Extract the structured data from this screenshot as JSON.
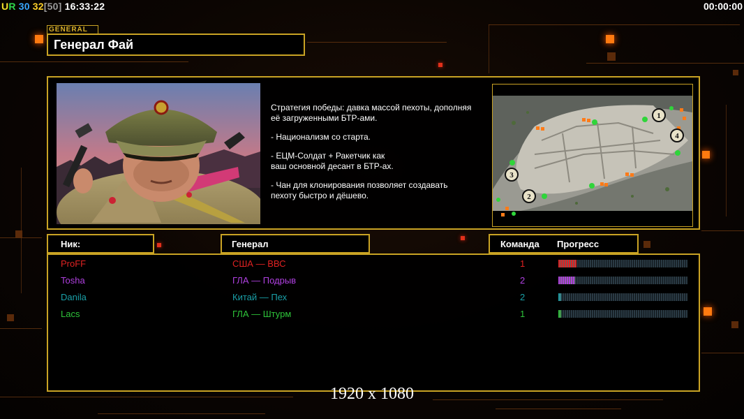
{
  "hud": {
    "ur_u": "U",
    "ur_r": "R",
    "num1": "30",
    "num2": "32",
    "num3": "[50]",
    "clock": "16:33:22",
    "timer": "00:00:00"
  },
  "header": {
    "tag": "GENERAL",
    "title": "Генерал Фай"
  },
  "briefing": {
    "paragraphs": [
      "Стратегия победы: давка массой пехоты, дополняя\n её загруженными БТР-ами.",
      "- Национализм со старта.",
      "- ЕЦМ-Солдат + Ракетчик как\nваш основной десант в БТР-ах.",
      "- Чан для клонирования позволяет создавать\n пехоту быстро и дёшево."
    ],
    "portrait_subject": "general-portrait",
    "map_subject": "minimap",
    "map_markers": [
      "1",
      "2",
      "3",
      "4"
    ]
  },
  "columns": {
    "nick": "Ник:",
    "general": "Генерал",
    "team": "Команда",
    "progress": "Прогресс"
  },
  "players": [
    {
      "nick": "ProFF",
      "general": "США — ВВС",
      "team": "1",
      "progress": 0.14,
      "color": "#e02222"
    },
    {
      "nick": "Tosha",
      "general": "ГЛА — Подрыв",
      "team": "2",
      "progress": 0.13,
      "color": "#b040e0"
    },
    {
      "nick": "Danila",
      "general": "Китай — Пех",
      "team": "2",
      "progress": 0.02,
      "color": "#1aa0a8"
    },
    {
      "nick": "Lacs",
      "general": "ГЛА — Штурм",
      "team": "1",
      "progress": 0.02,
      "color": "#2ec43a"
    }
  ],
  "footer": {
    "resolution": "1920 x 1080"
  },
  "colors": {
    "frame": "#c9a324",
    "accent": "#ff7a10"
  }
}
